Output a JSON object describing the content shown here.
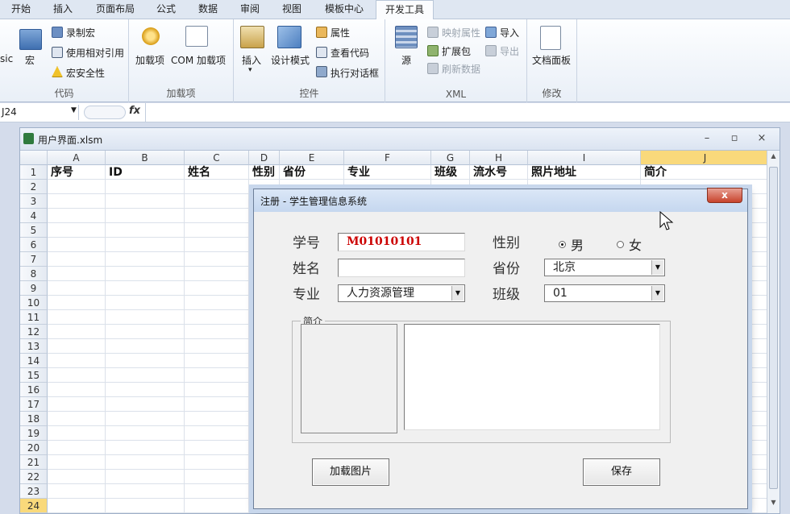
{
  "ribbon_tabs": [
    "开始",
    "插入",
    "页面布局",
    "公式",
    "数据",
    "审阅",
    "视图",
    "模板中心",
    "开发工具"
  ],
  "active_tab": "开发工具",
  "groups": {
    "code": {
      "label": "代码",
      "vb_partial": "sic",
      "macro": "宏",
      "record_macro": "录制宏",
      "relative_ref": "使用相对引用",
      "macro_security": "宏安全性"
    },
    "addins": {
      "label": "加载项",
      "addins": "加载项",
      "com_addins": "COM 加载项"
    },
    "controls": {
      "label": "控件",
      "insert": "插入",
      "design_mode": "设计模式",
      "properties": "属性",
      "view_code": "查看代码",
      "run_dialog": "执行对话框"
    },
    "xml": {
      "label": "XML",
      "source": "源",
      "map_props": "映射属性",
      "expansion": "扩展包",
      "refresh": "刷新数据",
      "import": "导入",
      "export": "导出"
    },
    "modify": {
      "label": "修改",
      "doc_panel": "文档面板"
    }
  },
  "formula_bar": {
    "name_box": "J24",
    "fx": "fx",
    "formula": ""
  },
  "workbook": {
    "title": "用户界面.xlsm",
    "columns": [
      "A",
      "B",
      "C",
      "D",
      "E",
      "F",
      "G",
      "H",
      "I",
      "J"
    ],
    "selected_column": "J",
    "selected_row": "24",
    "rows": [
      "1",
      "2",
      "3",
      "4",
      "5",
      "6",
      "7",
      "8",
      "9",
      "10",
      "11",
      "12",
      "13",
      "14",
      "15",
      "16",
      "17",
      "18",
      "19",
      "20",
      "21",
      "22",
      "23",
      "24"
    ],
    "headers": [
      "序号",
      "ID",
      "姓名",
      "性别",
      "省份",
      "专业",
      "班级",
      "流水号",
      "照片地址",
      "简介"
    ]
  },
  "dialog": {
    "title": "注册 - 学生管理信息系统",
    "close": "x",
    "student_id_label": "学号",
    "student_id_value": "M01010101",
    "name_label": "姓名",
    "name_value": "",
    "major_label": "专业",
    "major_value": "人力资源管理",
    "gender_label": "性别",
    "gender_male": "男",
    "gender_female": "女",
    "gender_selected": "男",
    "province_label": "省份",
    "province_value": "北京",
    "class_label": "班级",
    "class_value": "01",
    "intro_frame_label": "简介",
    "intro_value": "",
    "load_photo_button": "加载图片",
    "save_button": "保存"
  },
  "colors": {
    "selection_header": "#f9d97b",
    "student_id_text": "#cc0000",
    "close_button": "#c7432c"
  }
}
